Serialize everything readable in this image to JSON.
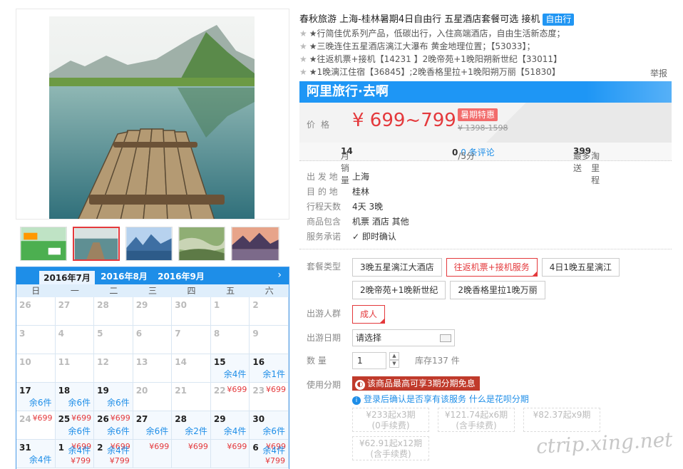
{
  "product": {
    "title": "春秋旅游 上海-桂林暑期4日自由行 五星酒店套餐可选 接机",
    "tag": "自由行",
    "report": "举报",
    "features": [
      "★行简佳优系列产品，低碳出行，入住高端酒店，自由生活新态度；",
      "★三晚连住五星酒店漓江大瀑布 黄金地理位置；【53033】；",
      "★往返机票+接机【14231 】2晚帝苑+1晚阳朔新世纪【33011】",
      "★1晚漓江住宿【36845】;2晚香格里拉+1晚阳朔万丽【51830】"
    ]
  },
  "banner": {
    "text": "阿里旅行·去啊"
  },
  "price": {
    "label": "价格",
    "value": "¥ 699~799",
    "badge": "暑期特惠",
    "old": "¥ 1398-1598"
  },
  "stats": {
    "sales_label": "月销量",
    "sales": "14",
    "score": "0",
    "score_unit": "/5分",
    "reviews": "0 条评论",
    "points_label": "最多送",
    "points": "399",
    "points_unit": "淘里程"
  },
  "info": [
    {
      "k": "出 发 地",
      "v": "上海"
    },
    {
      "k": "目 的 地",
      "v": "桂林"
    },
    {
      "k": "行程天数",
      "v": "4天 3晚"
    },
    {
      "k": "商品包含",
      "v": "机票  酒店  其他"
    },
    {
      "k": "服务承诺",
      "v": "即时确认"
    }
  ],
  "package": {
    "label": "套餐类型",
    "options": [
      "3晚五星漓江大酒店",
      "往返机票+接机服务",
      "4日1晚五星漓江",
      "2晚帝苑+1晚新世纪",
      "2晚香格里拉1晚万丽"
    ],
    "selected": 1
  },
  "crowd": {
    "label": "出游人群",
    "option": "成人"
  },
  "date": {
    "label": "出游日期",
    "placeholder": "请选择"
  },
  "quantity": {
    "label": "数  量",
    "value": "1",
    "stock": "库存137 件"
  },
  "installment": {
    "label": "使用分期",
    "banner": "该商品最高可享3期分期免息",
    "tip": "登录后确认是否享有该服务",
    "link": "什么是花呗分期",
    "plans": [
      {
        "l1": "¥233起x3期",
        "l2": "(0手续费)"
      },
      {
        "l1": "¥121.74起x6期",
        "l2": "(含手续费)"
      },
      {
        "l1": "¥82.37起x9期",
        "l2": ""
      },
      {
        "l1": "¥62.91起x12期",
        "l2": "(含手续费)"
      }
    ]
  },
  "calendar": {
    "tabs": [
      "2016年7月",
      "2016年8月",
      "2016年9月"
    ],
    "next": "›",
    "weekdays": [
      "日",
      "一",
      "二",
      "三",
      "四",
      "五",
      "六"
    ],
    "cells": [
      {
        "d": "26",
        "dis": true
      },
      {
        "d": "27",
        "dis": true
      },
      {
        "d": "28",
        "dis": true
      },
      {
        "d": "29",
        "dis": true
      },
      {
        "d": "30",
        "dis": true
      },
      {
        "d": "1",
        "dis": true
      },
      {
        "d": "2",
        "dis": true
      },
      {
        "d": "3",
        "dis": true
      },
      {
        "d": "4",
        "dis": true
      },
      {
        "d": "5",
        "dis": true
      },
      {
        "d": "6",
        "dis": true
      },
      {
        "d": "7",
        "dis": true
      },
      {
        "d": "8",
        "dis": true
      },
      {
        "d": "9",
        "dis": true
      },
      {
        "d": "10",
        "dis": true
      },
      {
        "d": "11",
        "dis": true
      },
      {
        "d": "12",
        "dis": true
      },
      {
        "d": "13",
        "dis": true
      },
      {
        "d": "14",
        "dis": true
      },
      {
        "d": "15",
        "s": "余4件"
      },
      {
        "d": "16",
        "s": "余1件"
      },
      {
        "d": "17",
        "s": "余6件"
      },
      {
        "d": "18",
        "s": "余6件"
      },
      {
        "d": "19",
        "s": "余6件"
      },
      {
        "d": "20",
        "dis": true
      },
      {
        "d": "21",
        "dis": true
      },
      {
        "d": "22",
        "p": "¥699",
        "dis": true
      },
      {
        "d": "23",
        "p": "¥699",
        "dis": true
      },
      {
        "d": "24",
        "p": "¥699",
        "dis": true
      },
      {
        "d": "25",
        "p": "¥699",
        "s": "余6件"
      },
      {
        "d": "26",
        "p": "¥699",
        "s": "余6件"
      },
      {
        "d": "27",
        "s": "余6件"
      },
      {
        "d": "28",
        "s": "余2件"
      },
      {
        "d": "29",
        "s": "余4件"
      },
      {
        "d": "30",
        "s": "余6件"
      },
      {
        "d": "31",
        "s": "余4件"
      },
      {
        "d": "1",
        "p": "¥699",
        "s": "余4件",
        "p2": "¥799"
      },
      {
        "d": "2",
        "p": "¥699",
        "s": "余4件",
        "p2": "¥799"
      },
      {
        "d": "",
        "p": "¥699"
      },
      {
        "d": "",
        "p": "¥699"
      },
      {
        "d": "",
        "p": "¥699"
      },
      {
        "d": "6",
        "p": "¥699",
        "s": "余4件",
        "p2": "¥799"
      }
    ]
  },
  "watermark": "ctrip.xing.net"
}
